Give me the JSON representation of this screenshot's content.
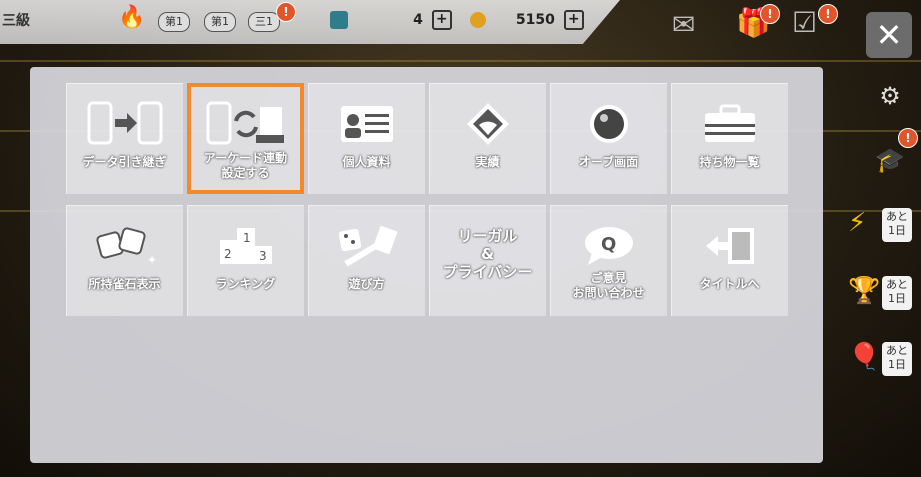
{
  "topbar": {
    "rank_text": "三級",
    "pills": [
      "第1",
      "第1",
      "三1"
    ],
    "tickets": "4",
    "coins": "5150"
  },
  "menu": {
    "items": [
      {
        "label": "データ引き継ぎ",
        "icon": "device-transfer-icon"
      },
      {
        "label": "アーケード連動\n設定する",
        "icon": "arcade-link-icon",
        "selected": true
      },
      {
        "label": "個人資料",
        "icon": "profile-card-icon"
      },
      {
        "label": "実績",
        "icon": "stadium-icon"
      },
      {
        "label": "オーブ画面",
        "icon": "orb-icon"
      },
      {
        "label": "持ち物一覧",
        "icon": "briefcase-icon"
      },
      {
        "label": "所持雀石表示",
        "icon": "gems-icon"
      },
      {
        "label": "ランキング",
        "icon": "podium-icon"
      },
      {
        "label": "遊び方",
        "icon": "dice-icon"
      },
      {
        "label": "リーガル\n&\nプライバシー",
        "icon": "",
        "text_only": true
      },
      {
        "label": "ご意見\nお問い合わせ",
        "icon": "q-bubble-icon"
      },
      {
        "label": "タイトルへ",
        "icon": "exit-door-icon"
      }
    ]
  },
  "side": {
    "atoichi_label": "あと\n1日"
  },
  "colors": {
    "accent": "#f08a2a",
    "panel": "#d7d7de",
    "badge": "#e0552a"
  }
}
